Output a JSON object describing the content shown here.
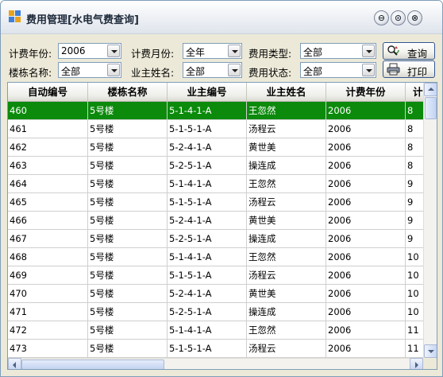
{
  "window": {
    "title": "费用管理[水电气费查询]",
    "controls": [
      "⊖",
      "⊙",
      "⊗"
    ]
  },
  "filters": {
    "year_label": "计费年份:",
    "year_value": "2006",
    "month_label": "计费月份:",
    "month_value": "全年",
    "type_label": "费用类型:",
    "type_value": "全部",
    "building_label": "楼栋名称:",
    "building_value": "全部",
    "owner_label": "业主姓名:",
    "owner_value": "全部",
    "status_label": "费用状态:",
    "status_value": "全部"
  },
  "buttons": {
    "query_label": "查询",
    "print_label": "打印"
  },
  "grid": {
    "columns": [
      "自动编号",
      "楼栋名称",
      "业主编号",
      "业主姓名",
      "计费年份",
      "计"
    ],
    "rows": [
      [
        "460",
        "5号楼",
        "5-1-4-1-A",
        "王忽然",
        "2006",
        "8"
      ],
      [
        "461",
        "5号楼",
        "5-1-5-1-A",
        "汤程云",
        "2006",
        "8"
      ],
      [
        "462",
        "5号楼",
        "5-2-4-1-A",
        "黄世美",
        "2006",
        "8"
      ],
      [
        "463",
        "5号楼",
        "5-2-5-1-A",
        "操连成",
        "2006",
        "8"
      ],
      [
        "464",
        "5号楼",
        "5-1-4-1-A",
        "王忽然",
        "2006",
        "9"
      ],
      [
        "465",
        "5号楼",
        "5-1-5-1-A",
        "汤程云",
        "2006",
        "9"
      ],
      [
        "466",
        "5号楼",
        "5-2-4-1-A",
        "黄世美",
        "2006",
        "9"
      ],
      [
        "467",
        "5号楼",
        "5-2-5-1-A",
        "操连成",
        "2006",
        "9"
      ],
      [
        "468",
        "5号楼",
        "5-1-4-1-A",
        "王忽然",
        "2006",
        "10"
      ],
      [
        "469",
        "5号楼",
        "5-1-5-1-A",
        "汤程云",
        "2006",
        "10"
      ],
      [
        "470",
        "5号楼",
        "5-2-4-1-A",
        "黄世美",
        "2006",
        "10"
      ],
      [
        "471",
        "5号楼",
        "5-2-5-1-A",
        "操连成",
        "2006",
        "10"
      ],
      [
        "472",
        "5号楼",
        "5-1-4-1-A",
        "王忽然",
        "2006",
        "11"
      ],
      [
        "473",
        "5号楼",
        "5-1-5-1-A",
        "汤程云",
        "2006",
        "11"
      ]
    ],
    "selected_row_index": 0,
    "selection_color": "#0b8a0b"
  },
  "icons": {
    "app": "app-window-icon",
    "query": "search-icon",
    "print": "printer-icon"
  }
}
